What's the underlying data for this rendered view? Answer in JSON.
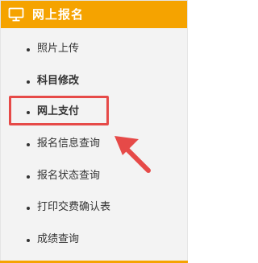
{
  "header": {
    "title": "网上报名",
    "icon": "monitor-icon"
  },
  "menu": {
    "items": [
      {
        "label": "照片上传",
        "bold": false
      },
      {
        "label": "科目修改",
        "bold": true
      },
      {
        "label": "网上支付",
        "bold": true
      },
      {
        "label": "报名信息查询",
        "bold": false
      },
      {
        "label": "报名状态查询",
        "bold": false
      },
      {
        "label": "打印交费确认表",
        "bold": false
      },
      {
        "label": "成绩查询",
        "bold": false
      }
    ]
  },
  "colors": {
    "header_bg": "#f5a300",
    "highlight": "#e64a48",
    "panel_bg": "#f3f3f3"
  }
}
